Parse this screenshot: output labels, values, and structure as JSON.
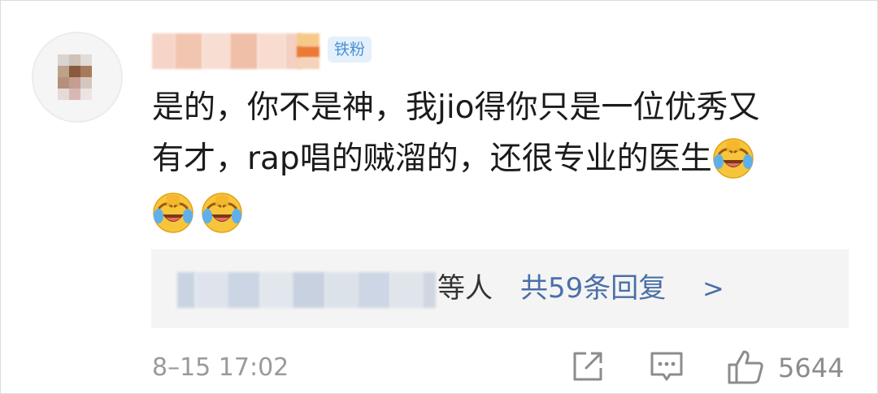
{
  "comment": {
    "username_obscured": true,
    "badge": "铁粉",
    "text_line1": "是的，你不是神，我jio得你只是一位优秀又",
    "text_line2": "有才，rap唱的贼溜的，还很专业的医生",
    "emojis": [
      "laughing-crying-emoji",
      "laughing-crying-emoji",
      "laughing-crying-emoji"
    ],
    "replies": {
      "names_obscured": true,
      "etc": "等人",
      "count_text": "共59条回复",
      "arrow": ">"
    },
    "timestamp": "8–15 17:02",
    "likes": "5644",
    "icons": {
      "share": "share-icon",
      "reply": "comment-icon",
      "like": "thumbs-up-icon"
    }
  },
  "colors": {
    "badge_bg": "#e4f0fb",
    "badge_text": "#4c8fd6",
    "link": "#4a6fa8",
    "meta": "#9a9a9a"
  }
}
